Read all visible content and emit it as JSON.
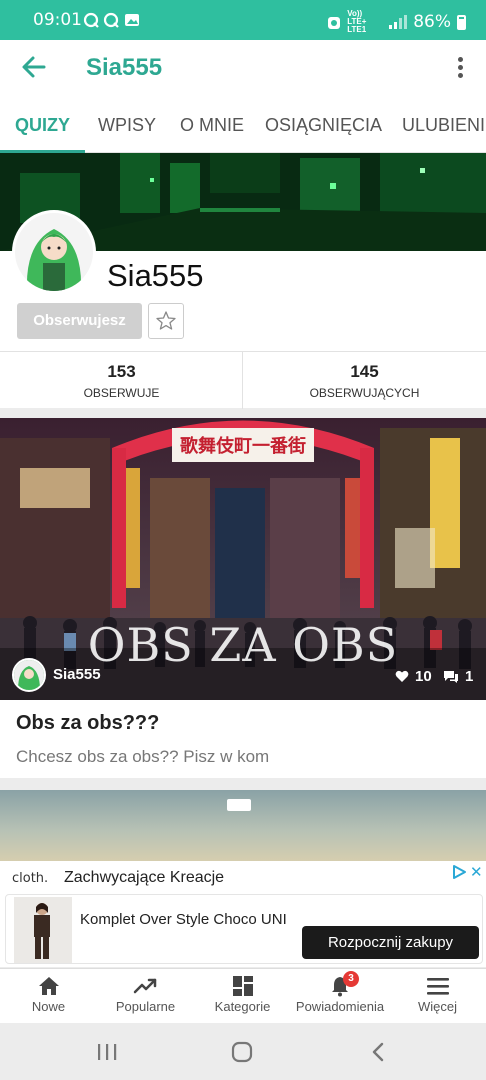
{
  "status_bar": {
    "time": "09:01",
    "battery": "86%",
    "network": "LTE+",
    "carrier_line": "Vo)) LTE+ LTE1"
  },
  "app_bar": {
    "title": "Sia555"
  },
  "tabs": [
    {
      "label": "QUIZY",
      "active": true
    },
    {
      "label": "WPISY",
      "active": false
    },
    {
      "label": "O MNIE",
      "active": false
    },
    {
      "label": "OSIĄGNIĘCIA",
      "active": false
    },
    {
      "label": "ULUBIENI",
      "active": false
    }
  ],
  "profile": {
    "username": "Sia555",
    "follow_button": "Obserwujesz",
    "stats": [
      {
        "value": "153",
        "label": "OBSERWUJE"
      },
      {
        "value": "145",
        "label": "OBSERWUJĄCYCH"
      }
    ]
  },
  "quiz": {
    "overlay_text": "OBS ZA OBS",
    "sign_text": "歌舞伎町一番街",
    "author": "Sia555",
    "likes": "10",
    "comments": "1",
    "title": "Obs za obs???",
    "description": "Chcesz obs za obs?? Pisz w kom"
  },
  "ad": {
    "brand": "cloth.",
    "headline": "Zachwycające Kreacje",
    "product": "Komplet Over Style Choco UNI",
    "cta": "Rozpocznij zakupy"
  },
  "bottom_nav": [
    {
      "label": "Nowe",
      "icon": "home-icon"
    },
    {
      "label": "Popularne",
      "icon": "trending-icon"
    },
    {
      "label": "Kategorie",
      "icon": "grid-icon"
    },
    {
      "label": "Powiadomienia",
      "icon": "bell-icon",
      "badge": "3"
    },
    {
      "label": "Więcej",
      "icon": "hamburger-icon"
    }
  ],
  "colors": {
    "accent": "#2ea892",
    "status_bar": "#2fbf9f",
    "badge": "#e53935"
  }
}
